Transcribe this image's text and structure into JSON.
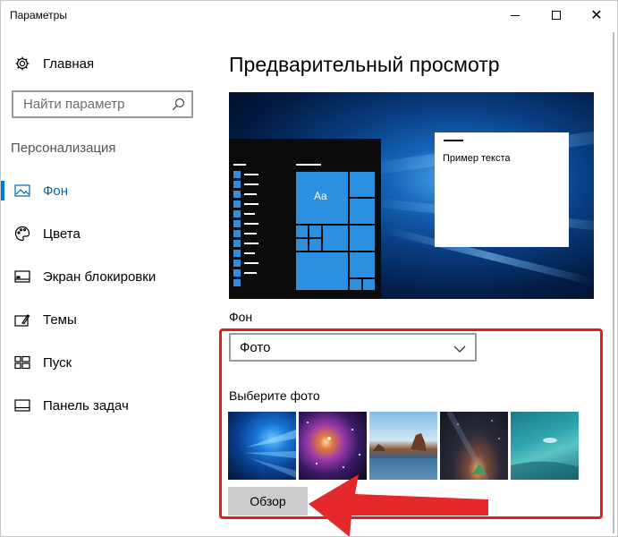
{
  "window": {
    "title": "Параметры",
    "controls": {
      "minimize": "minimize-icon",
      "maximize": "maximize-icon",
      "close": "close-icon"
    }
  },
  "sidebar": {
    "home_label": "Главная",
    "search_placeholder": "Найти параметр",
    "section_title": "Персонализация",
    "items": [
      {
        "label": "Фон",
        "icon": "picture-icon",
        "active": true
      },
      {
        "label": "Цвета",
        "icon": "palette-icon",
        "active": false
      },
      {
        "label": "Экран блокировки",
        "icon": "lock-screen-icon",
        "active": false
      },
      {
        "label": "Темы",
        "icon": "themes-icon",
        "active": false
      },
      {
        "label": "Пуск",
        "icon": "start-icon",
        "active": false
      },
      {
        "label": "Панель задач",
        "icon": "taskbar-icon",
        "active": false
      }
    ]
  },
  "main": {
    "title": "Предварительный просмотр",
    "preview": {
      "tile_text": "Aa",
      "sample_text": "Пример текста"
    },
    "background_label": "Фон",
    "background_value": "Фото",
    "choose_photo_label": "Выберите фото",
    "photos": [
      "windows-hero-photo",
      "nebula-photo",
      "beach-rocks-photo",
      "night-sky-photo",
      "underwater-photo"
    ],
    "browse_label": "Обзор"
  },
  "colors": {
    "accent": "#0078d7",
    "highlight": "#e21d1d",
    "tile": "#2d8fe0"
  }
}
